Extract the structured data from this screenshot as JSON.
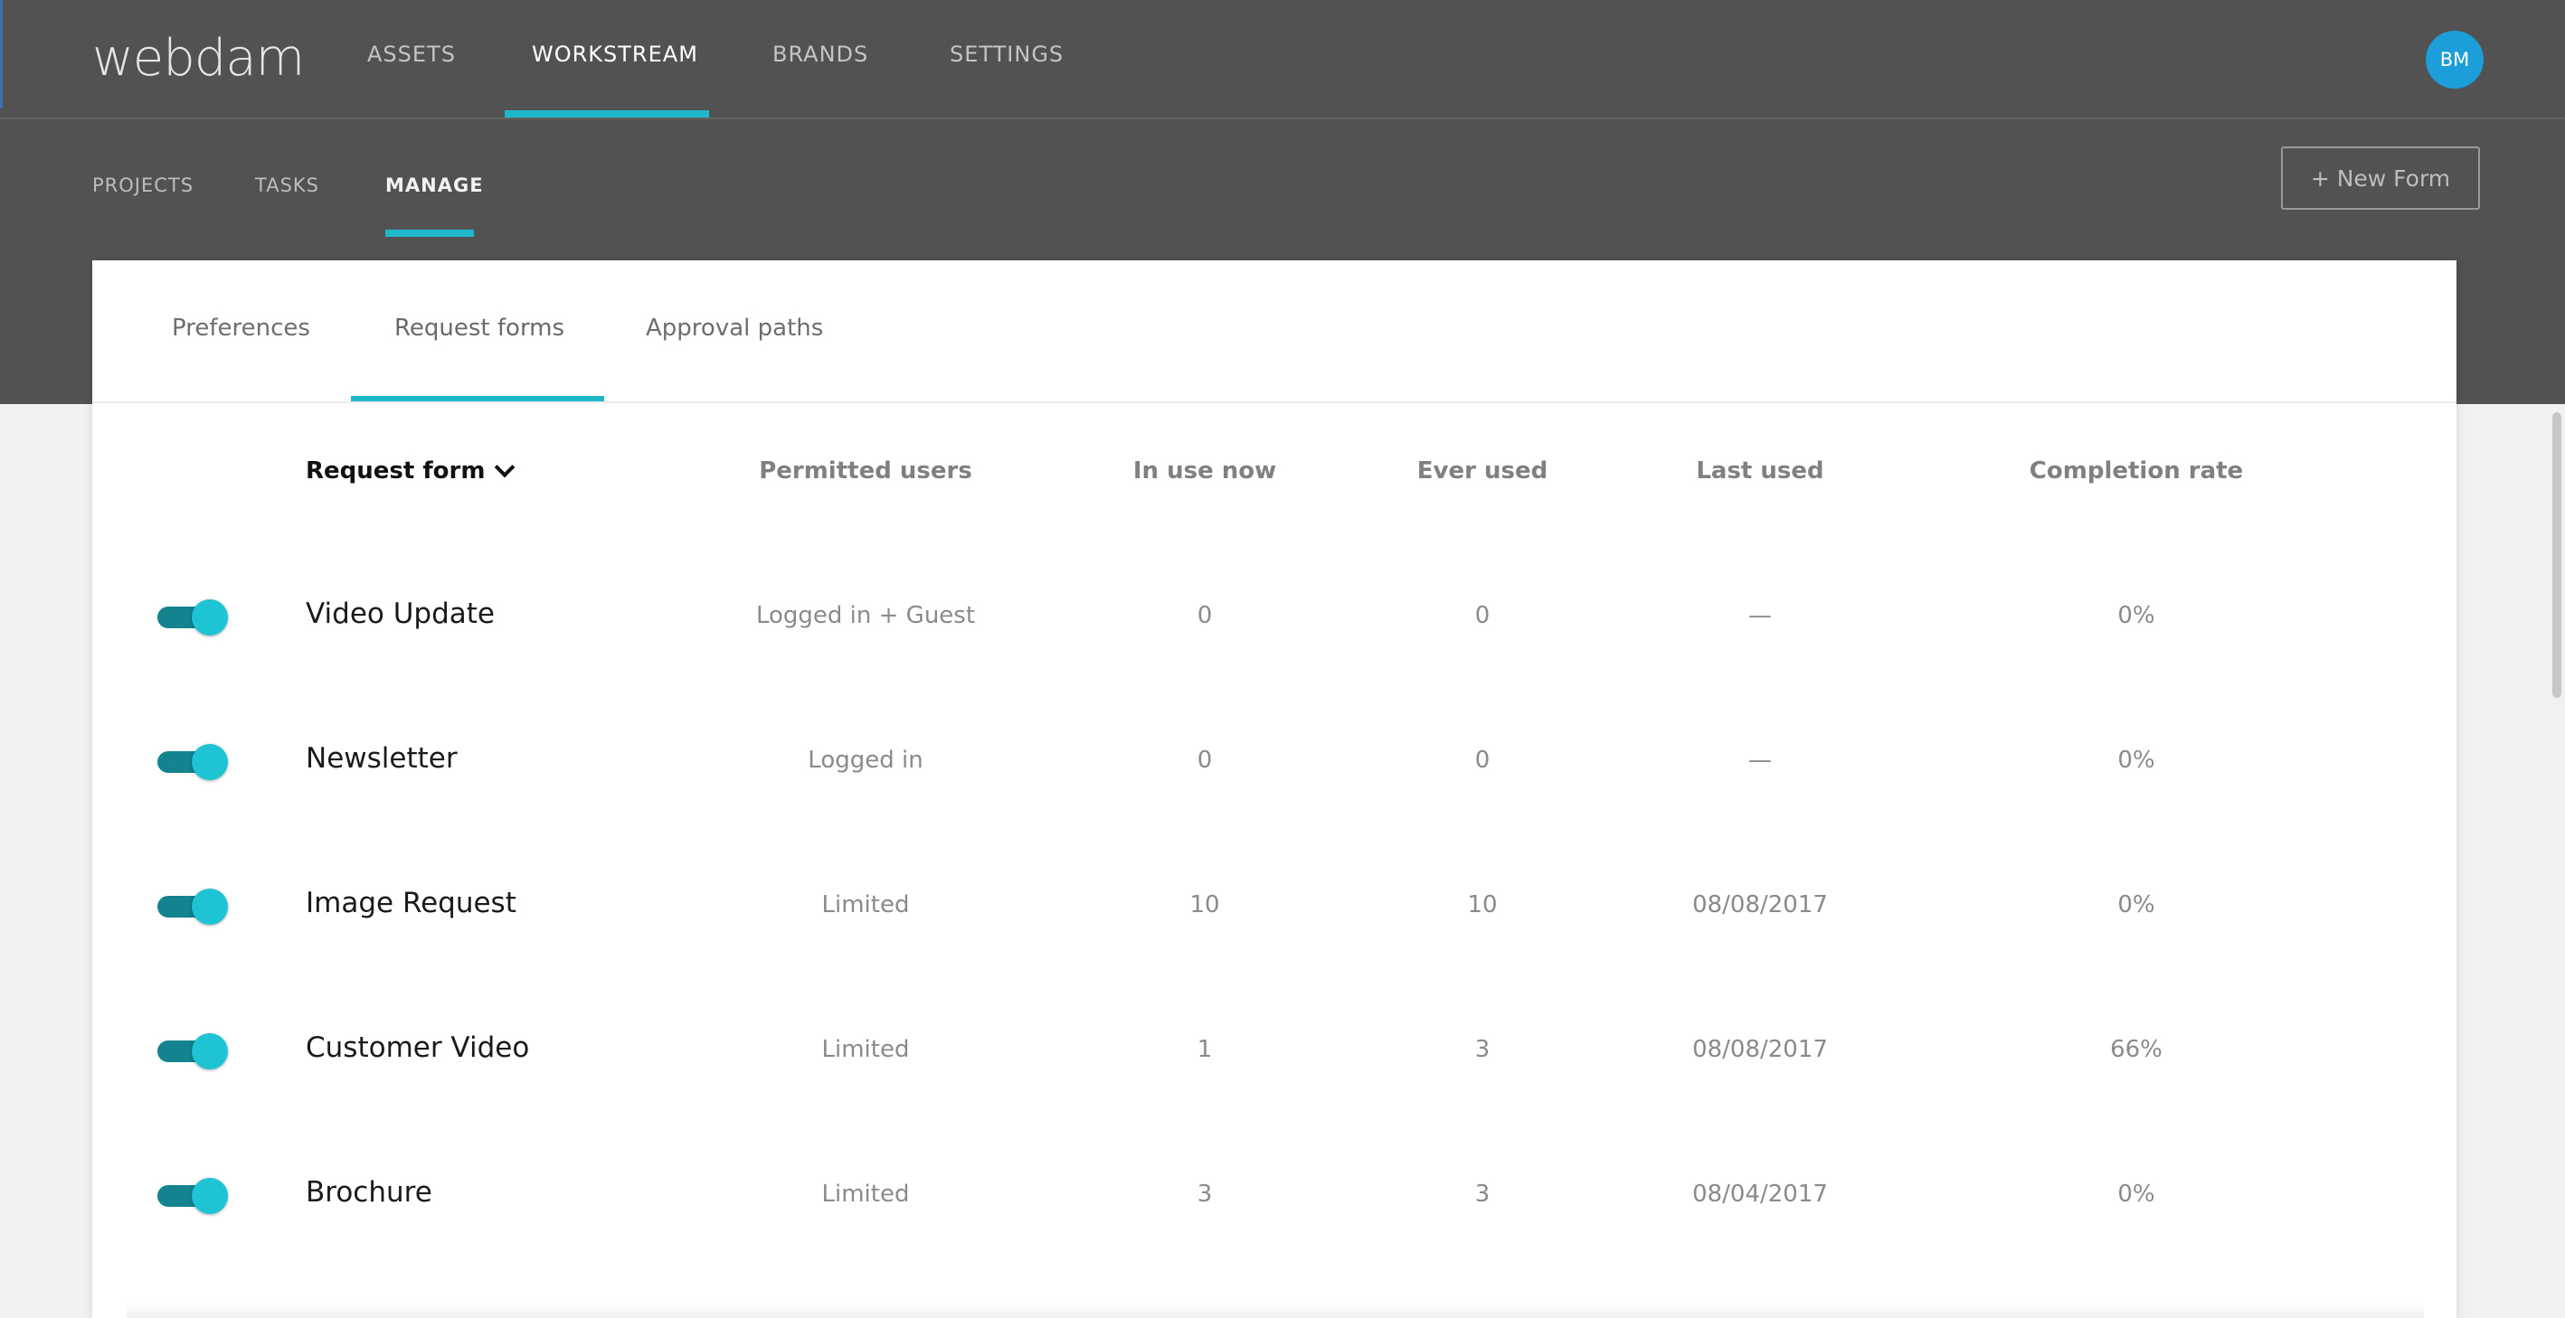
{
  "app": {
    "logo": "webdam"
  },
  "main_nav": {
    "items": [
      {
        "label": "ASSETS"
      },
      {
        "label": "WORKSTREAM"
      },
      {
        "label": "BRANDS"
      },
      {
        "label": "SETTINGS"
      }
    ],
    "active": "WORKSTREAM"
  },
  "user": {
    "initials": "BM"
  },
  "sub_nav": {
    "items": [
      {
        "label": "PROJECTS"
      },
      {
        "label": "TASKS"
      },
      {
        "label": "MANAGE"
      }
    ],
    "active": "MANAGE"
  },
  "actions": {
    "new_form_label": "+ New Form"
  },
  "card_tabs": {
    "items": [
      {
        "label": "Preferences"
      },
      {
        "label": "Request forms"
      },
      {
        "label": "Approval paths"
      }
    ],
    "active": "Request forms"
  },
  "table": {
    "headers": {
      "name": "Request form",
      "permitted_users": "Permitted users",
      "in_use_now": "In use now",
      "ever_used": "Ever used",
      "last_used": "Last used",
      "completion_rate": "Completion rate"
    },
    "rows": [
      {
        "enabled": true,
        "name": "Video Update",
        "permitted_users": "Logged in + Guest",
        "in_use_now": "0",
        "ever_used": "0",
        "last_used": "—",
        "completion_rate": "0%"
      },
      {
        "enabled": true,
        "name": "Newsletter",
        "permitted_users": "Logged in",
        "in_use_now": "0",
        "ever_used": "0",
        "last_used": "—",
        "completion_rate": "0%"
      },
      {
        "enabled": true,
        "name": "Image Request",
        "permitted_users": "Limited",
        "in_use_now": "10",
        "ever_used": "10",
        "last_used": "08/08/2017",
        "completion_rate": "0%"
      },
      {
        "enabled": true,
        "name": "Customer Video",
        "permitted_users": "Limited",
        "in_use_now": "1",
        "ever_used": "3",
        "last_used": "08/08/2017",
        "completion_rate": "66%"
      },
      {
        "enabled": true,
        "name": "Brochure",
        "permitted_users": "Limited",
        "in_use_now": "3",
        "ever_used": "3",
        "last_used": "08/04/2017",
        "completion_rate": "0%"
      }
    ]
  },
  "colors": {
    "header_bg": "#525252",
    "accent": "#1fb8cb",
    "toggle_track": "#12838f",
    "toggle_knob": "#1ec4d4",
    "avatar": "#1b9ed9"
  }
}
